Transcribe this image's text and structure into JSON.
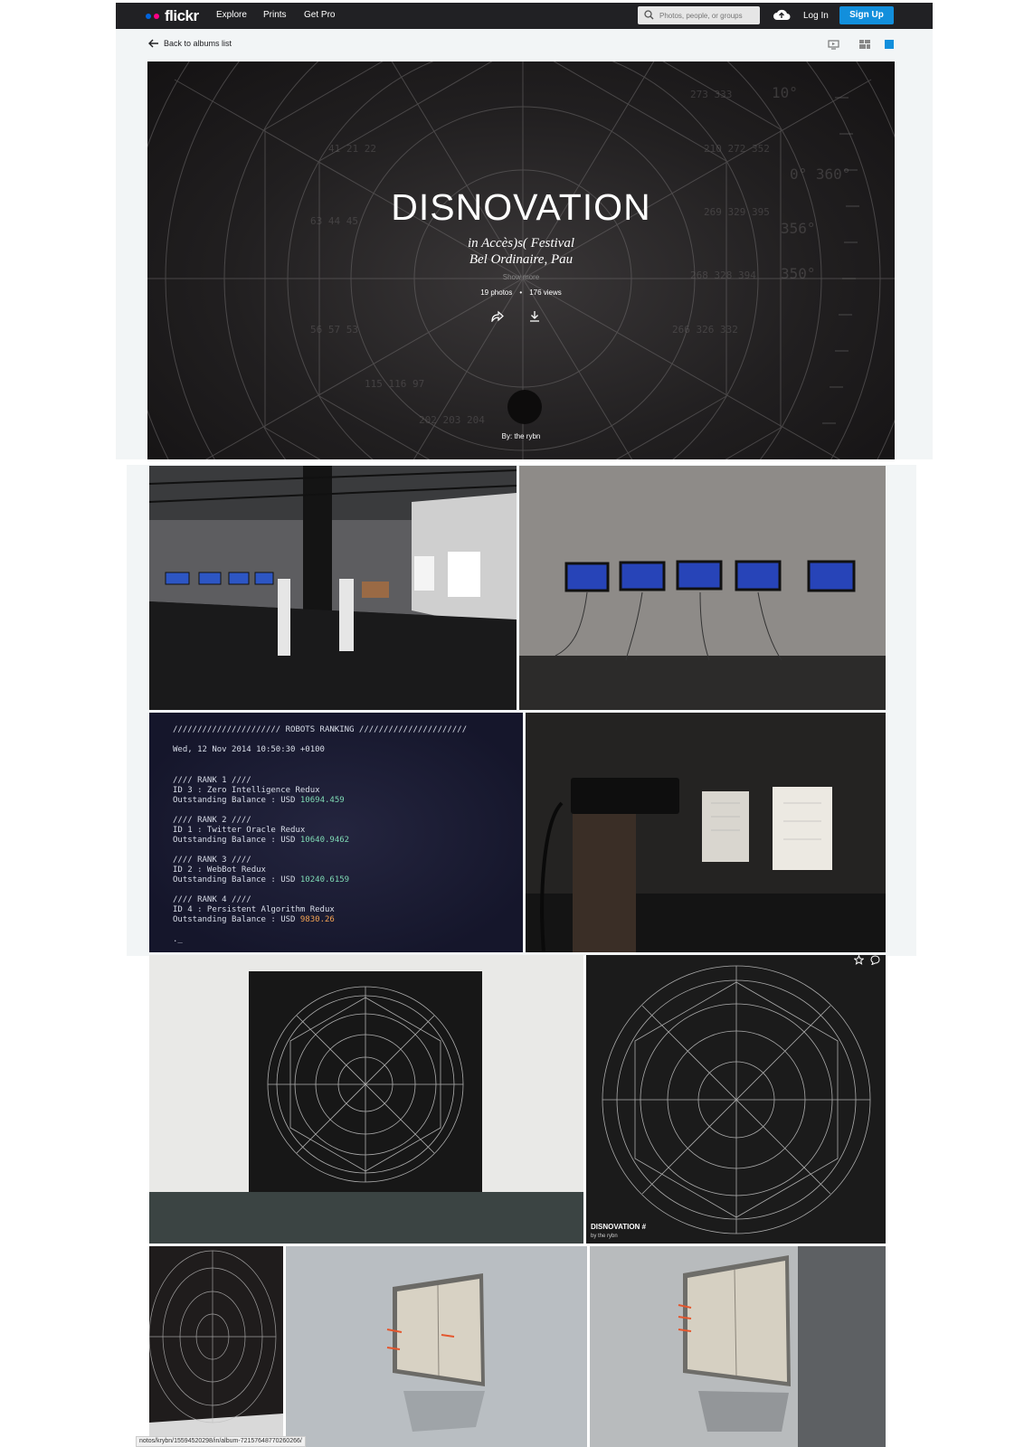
{
  "nav": {
    "logo_text": "flickr",
    "logo_colors": [
      "#0063dc",
      "#ff0084"
    ],
    "links": [
      "Explore",
      "Prints",
      "Get Pro"
    ],
    "search_placeholder": "Photos, people, or groups",
    "login": "Log In",
    "signup": "Sign Up",
    "accent": "#128fdc"
  },
  "subheader": {
    "back_label": "Back to albums list",
    "view_icons": [
      "slideshow-icon",
      "grid-view-icon",
      "single-view-icon"
    ]
  },
  "album": {
    "title": "DISNOVATION",
    "subtitle_line1": "in Accès)s( Festival",
    "subtitle_line2": "Bel Ordinaire, Pau",
    "show_more": "Show more",
    "photos": "19 photos",
    "separator": "•",
    "views": "176 views",
    "by": "By: the rybn"
  },
  "terminal": {
    "header": "////////////////////// ROBOTS RANKING //////////////////////",
    "date": "Wed, 12 Nov 2014 10:50:30 +0100",
    "ranks": [
      {
        "rank": "//// RANK 1 ////",
        "id": "ID 3 : Zero Intelligence Redux",
        "label": "Outstanding Balance : USD ",
        "value": "10694.459"
      },
      {
        "rank": "//// RANK 2 ////",
        "id": "ID 1 : Twitter Oracle Redux",
        "label": "Outstanding Balance : USD ",
        "value": "10640.9462"
      },
      {
        "rank": "//// RANK 3 ////",
        "id": "ID 2 : WebBot Redux",
        "label": "Outstanding Balance : USD ",
        "value": "10240.6159"
      },
      {
        "rank": "//// RANK 4 ////",
        "id": "ID 4 : Persistent Algorithm Redux",
        "label": "Outstanding Balance : USD ",
        "value": "9830.26"
      }
    ],
    "prompt": "._"
  },
  "hover_caption": {
    "title": "DISNOVATION #",
    "by": "by the rybn"
  },
  "status_url": "notos/krybn/15594520298/in/album-72157648770260266/"
}
